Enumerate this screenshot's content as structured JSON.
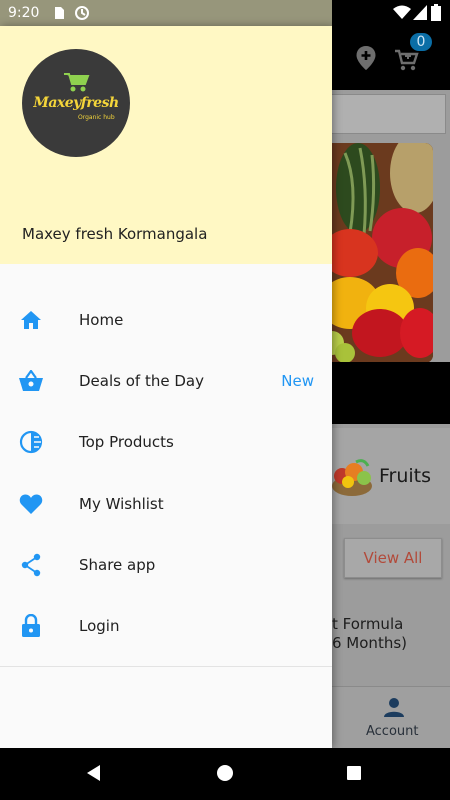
{
  "status_bar": {
    "time": "9:20"
  },
  "app": {
    "cart_count": "0",
    "category_label": "Fruits",
    "view_all_label": "View All",
    "product_title_line1": "t Formula",
    "product_title_line2": "6 Months)",
    "bottom_nav_account": "Account"
  },
  "drawer": {
    "logo_text": "Maxeyfresh",
    "logo_subtext": "Organic hub",
    "store_name": "Maxey fresh Kormangala",
    "menu_items": [
      {
        "label": "Home",
        "icon": "home-icon"
      },
      {
        "label": "Deals of the Day",
        "icon": "basket-icon",
        "badge": "New"
      },
      {
        "label": "Top Products",
        "icon": "top-products-icon"
      },
      {
        "label": "My Wishlist",
        "icon": "heart-icon"
      },
      {
        "label": "Share app",
        "icon": "share-icon"
      },
      {
        "label": "Login",
        "icon": "lock-icon"
      }
    ]
  },
  "colors": {
    "accent": "#2196f3",
    "drawer_header_bg": "#fff8c4",
    "badge_new": "#2196f3",
    "view_all_text": "#b24a3a"
  }
}
